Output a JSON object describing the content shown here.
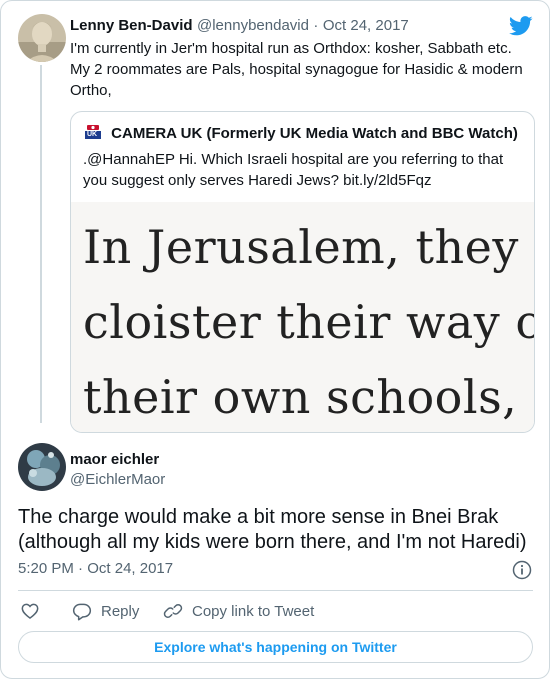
{
  "parent_tweet": {
    "author_name": "Lenny Ben-David",
    "author_handle": "@lennybendavid",
    "separator": "·",
    "date": "Oct 24, 2017",
    "text_lines": [
      "I'm currently in Jer'm hospital run as Orthdox: kosher, Sabbath etc.",
      "My 2 roommates are Pals, hospital synagogue for Hasidic & modern",
      "Ortho,"
    ]
  },
  "quoted_tweet": {
    "badge": "UK",
    "author_name": "CAMERA UK (Formerly UK Media Watch and BBC Watch)",
    "text_lines": [
      ".@HannahEP Hi. Which Israeli hospital are you referring to that",
      "you suggest only serves Haredi Jews?  bit.ly/2ld5Fqz"
    ],
    "image_lines": [
      "In Jerusalem, they",
      "cloister their way o",
      "their own schools, "
    ]
  },
  "main_tweet": {
    "author_name": "maor eichler",
    "author_handle": "@EichlerMaor",
    "text_lines": [
      "The charge would make a bit more sense in Bnei Brak",
      "(although all my kids were born there, and I'm not Haredi)"
    ],
    "time": "5:20 PM",
    "separator": "·",
    "date": "Oct 24, 2017"
  },
  "actions": {
    "reply_label": "Reply",
    "copy_link_label": "Copy link to Tweet"
  },
  "explore_label": "Explore what's happening on Twitter",
  "icons": {
    "brand": "twitter-bird-icon",
    "info": "info-icon",
    "like": "heart-icon",
    "reply": "reply-bubble-icon",
    "link": "link-icon"
  },
  "colors": {
    "accent": "#1d9bf0",
    "text": "#0f1419",
    "secondary": "#536471",
    "border": "#cfd9de"
  }
}
